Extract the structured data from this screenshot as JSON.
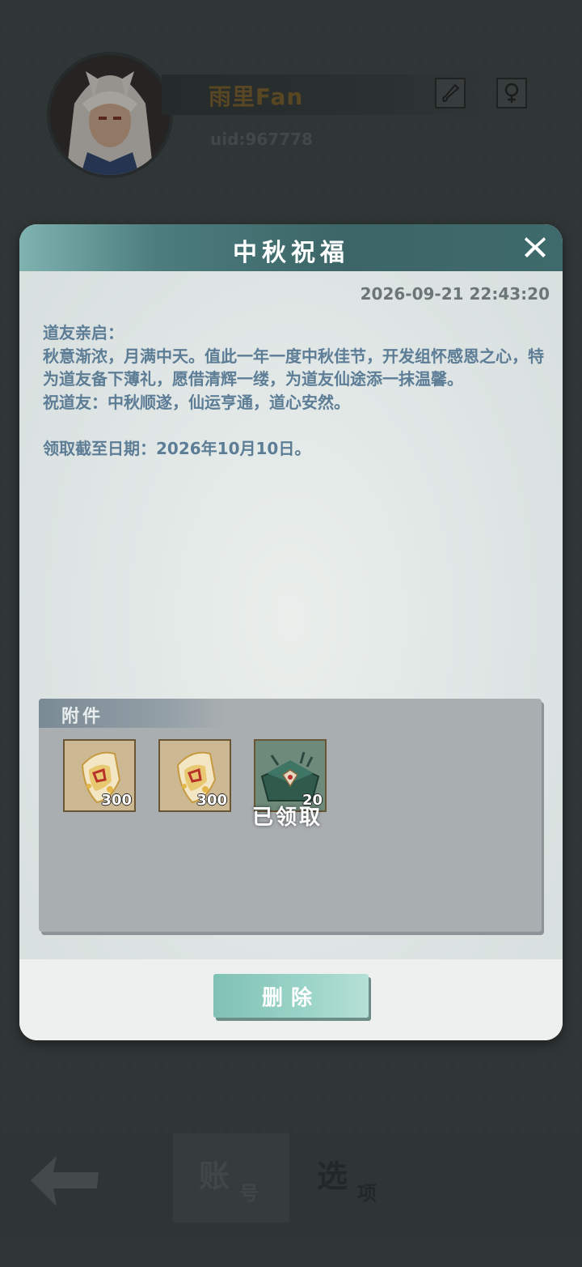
{
  "profile": {
    "name": "雨里Fan",
    "uid": "uid:967778"
  },
  "modal": {
    "title": "中秋祝福",
    "close_label": "X",
    "timestamp": "2026-09-21 22:43:20",
    "body": "道友亲启：\n秋意渐浓，月满中天。值此一年一度中秋佳节，开发组怀感恩之心，特为道友备下薄礼，愿借清辉一缕，为道友仙途添一抹温馨。\n祝道友：中秋顺遂，仙运亨通，道心安然。\n\n领取截至日期：2026年10月10日。",
    "attachments_label": "附件",
    "attachments": [
      {
        "icon": "spirit-stone-icon",
        "qty": "300"
      },
      {
        "icon": "spirit-stone-icon",
        "qty": "300"
      },
      {
        "icon": "treasure-box-icon",
        "qty": "20"
      }
    ],
    "claimed_label": "已领取",
    "delete_label": "删除"
  },
  "nav": {
    "account_big": "账",
    "account_small": "号",
    "options_big": "选",
    "options_small": "项"
  },
  "colors": {
    "header_teal": "#3c6567",
    "body_text": "#5d7d96",
    "delete_button": "#9bd4c8"
  }
}
